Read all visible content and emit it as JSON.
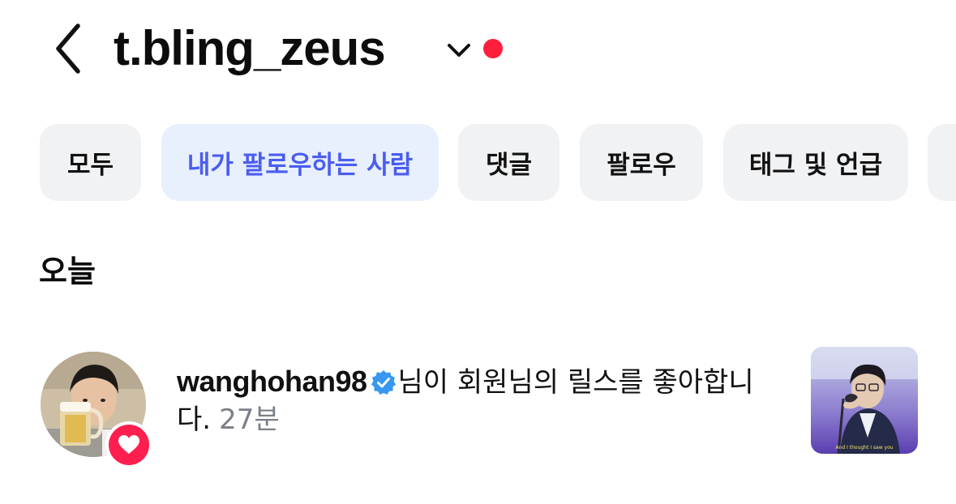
{
  "header": {
    "title": "t.bling_zeus",
    "back_icon": "chevron-left-icon",
    "switch_icon": "chevron-down-icon",
    "dot_color": "#ff1f3d"
  },
  "filters": {
    "chips": [
      {
        "label": "모두",
        "active": false
      },
      {
        "label": "내가 팔로우하는 사람",
        "active": true
      },
      {
        "label": "댓글",
        "active": false
      },
      {
        "label": "팔로우",
        "active": false
      },
      {
        "label": "태그 및 언급",
        "active": false
      }
    ],
    "active_color": "#4a5df0",
    "active_bg": "#e8effd",
    "inactive_bg": "#f1f2f4"
  },
  "section": {
    "title": "오늘"
  },
  "notification": {
    "username": "wanghohan98",
    "verified_icon": "verified-badge-icon",
    "verified_color": "#3897f0",
    "message": "님이 회원님의 릴스를 좋아합니다.",
    "time": "27분",
    "badge_icon": "heart-icon",
    "badge_color": "#ff1f4f",
    "thumbnail_caption": "And I thought I saw you"
  }
}
